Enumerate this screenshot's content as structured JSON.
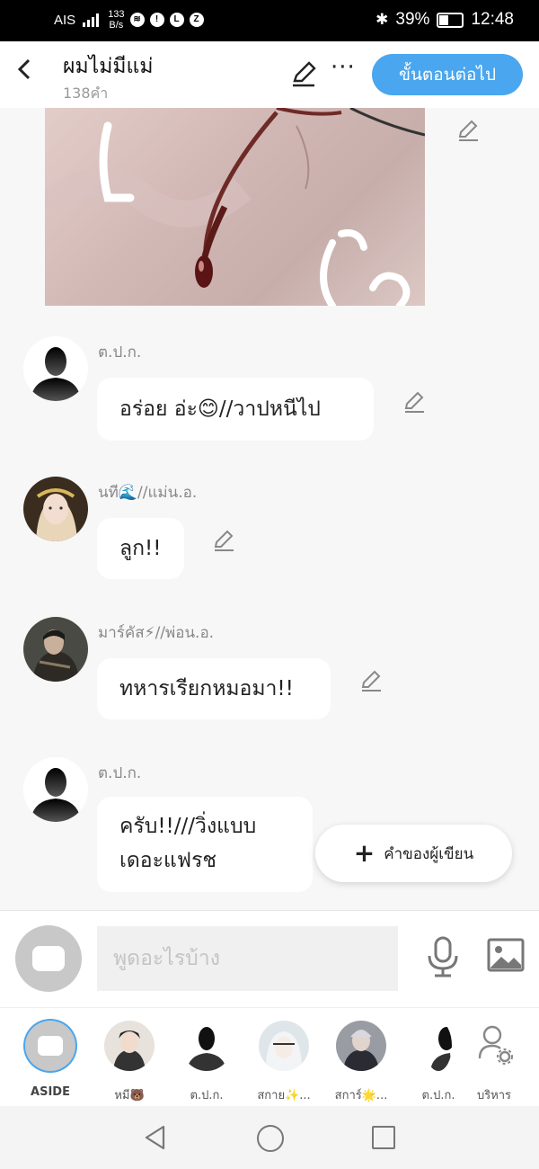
{
  "status_bar": {
    "carrier": "AIS",
    "net_speed": "133",
    "net_unit": "B/s",
    "battery": "39%",
    "time": "12:48"
  },
  "header": {
    "title": "ผมไม่มีแม่",
    "word_count": "138คำ",
    "next_step_label": "ขั้นตอนต่อไป"
  },
  "messages": [
    {
      "name": "ต.ป.ก.",
      "text": "อร่อย อ่ะ😊//วาปหนีไป"
    },
    {
      "name": "นที🌊//แม่น.อ.",
      "text": "ลูก!!"
    },
    {
      "name": "มาร์คัส⚡//พ่อน.อ.",
      "text": "ทหารเรียกหมอมา!!"
    },
    {
      "name": "ต.ป.ก.",
      "text": "ครับ!!///วิ่งแบบเดอะแฟรช"
    }
  ],
  "fab": {
    "label": "คำของผู้เขียน"
  },
  "input": {
    "placeholder": "พูดอะไรบ้าง"
  },
  "cast": [
    {
      "label": "ASIDE"
    },
    {
      "label": "หมี🐻"
    },
    {
      "label": "ต.ป.ก."
    },
    {
      "label": "สกาย✨..."
    },
    {
      "label": "สการ์🌟..."
    },
    {
      "label": "ต.ป.ก."
    },
    {
      "label": "บริหาร"
    }
  ],
  "colors": {
    "accent": "#4aa6ee",
    "status_bar": "#000000",
    "bubble": "#ffffff",
    "background": "#f7f7f7"
  },
  "icons": [
    "back-icon",
    "pen-icon",
    "more-icon",
    "edit-icon",
    "plus-icon",
    "microphone-icon",
    "image-icon",
    "manage-icon",
    "nav-back-icon",
    "nav-home-icon",
    "nav-recent-icon"
  ]
}
